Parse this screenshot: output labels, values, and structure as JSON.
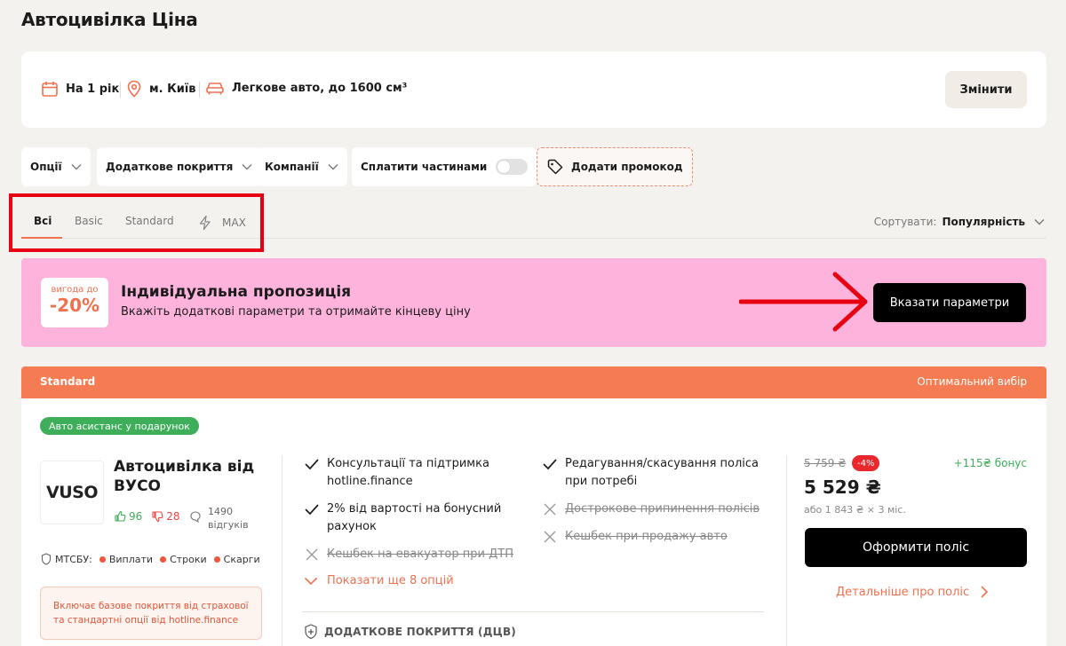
{
  "page": {
    "title": "Автоцивілка Ціна"
  },
  "params": {
    "period": "На 1 рік",
    "city": "м. Київ",
    "vehicle": "Легкове авто, до 1600 см³",
    "change_label": "Змінити"
  },
  "filters": {
    "options": "Опції",
    "extra_coverage": "Додаткове покриття",
    "companies": "Компанії",
    "installments": "Сплатити частинами",
    "promo": "Додати промокод"
  },
  "tabs": [
    "Всі",
    "Basic",
    "Standard",
    "MAX"
  ],
  "sort": {
    "label": "Сортувати:",
    "value": "Популярність"
  },
  "banner": {
    "discount_small": "вигода до",
    "discount_big": "-20%",
    "title": "Індивідуальна пропозиція",
    "subtitle": "Вкажіть додаткові параметри та отримайте кінцеву ціну",
    "button": "Вказати параметри"
  },
  "offer": {
    "tier": "Standard",
    "tag": "Оптимальний вибір",
    "gift": "Авто асистанс у подарунок",
    "logo_text": "VUSO",
    "company": "Автоцивілка від ВУСО",
    "likes": "96",
    "dislikes": "28",
    "reviews": "1490 відгуків",
    "mtsbu": {
      "label": "МТСБУ:",
      "items": [
        "Виплати",
        "Строки",
        "Скарги"
      ]
    },
    "info": "Включає базове покриття від страхової та стандартні опції від hotline.finance",
    "features_left": [
      {
        "text": "Консультації та підтримка hotline.finance",
        "on": true
      },
      {
        "text": "2% від вартості на бонусний рахунок",
        "on": true
      },
      {
        "text": "Кешбек на евакуатор при ДТП",
        "on": false
      }
    ],
    "features_right": [
      {
        "text": "Редагування/скасування полiса при потребі",
        "on": true
      },
      {
        "text": "Дострокове припинення полісів",
        "on": false
      },
      {
        "text": "Кешбек при продажу авто",
        "on": false
      }
    ],
    "more": "Показати ще 8 опцій",
    "additional_coverage": "ДОДАТКОВЕ ПОКРИТТЯ (ДЦВ)",
    "old_price": "5 759 ₴",
    "discount": "-4%",
    "bonus": "+115₴ бонус",
    "price": "5 529 ₴",
    "monthly": "або 1 843 ₴ × 3 міс.",
    "buy": "Оформити поліс",
    "details": "Детальніше про поліс"
  },
  "colors": {
    "accent": "#f07050",
    "banner": "#fdb3dc",
    "green": "#3fae5a",
    "annotation_red": "#e60012"
  }
}
